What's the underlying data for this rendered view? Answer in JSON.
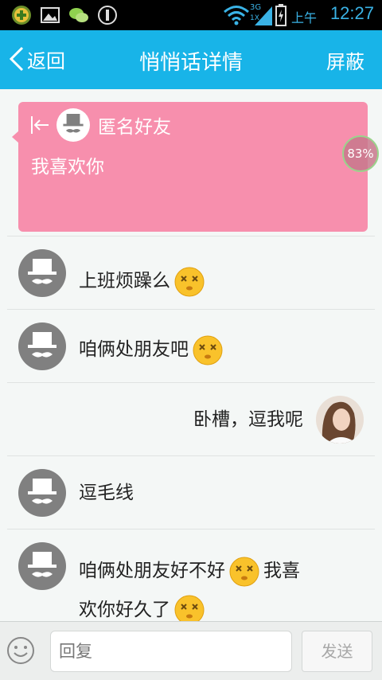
{
  "status_bar": {
    "ampm": "上午",
    "time": "12:27",
    "network": "3G",
    "network_sub": "1X",
    "icons": [
      "add-app-icon",
      "gallery-icon",
      "wechat-icon",
      "app-icon",
      "wifi-icon",
      "signal-icon",
      "battery-charging-icon"
    ]
  },
  "header": {
    "back_label": "返回",
    "title": "悄悄话详情",
    "block_label": "屏蔽",
    "bg_color": "#18b4e8"
  },
  "card": {
    "sender": "匿名好友",
    "message": "我喜欢你",
    "bg_color": "#f78fad"
  },
  "overlay_percent": "83%",
  "messages": [
    {
      "from": "friend",
      "text": "上班烦躁么",
      "emoji": "dizzy-face-emoji"
    },
    {
      "from": "friend",
      "text": "咱俩处朋友吧",
      "emoji": "dizzy-face-emoji"
    },
    {
      "from": "me",
      "text": "卧槽，逗我呢"
    },
    {
      "from": "friend",
      "text": "逗毛线"
    },
    {
      "from": "friend",
      "line1": "咱俩处朋友好不好",
      "line1_tail": "我喜",
      "line2": "欢你好久了",
      "emoji": "dizzy-face-emoji"
    }
  ],
  "input": {
    "placeholder": "回复",
    "send_label": "发送"
  }
}
